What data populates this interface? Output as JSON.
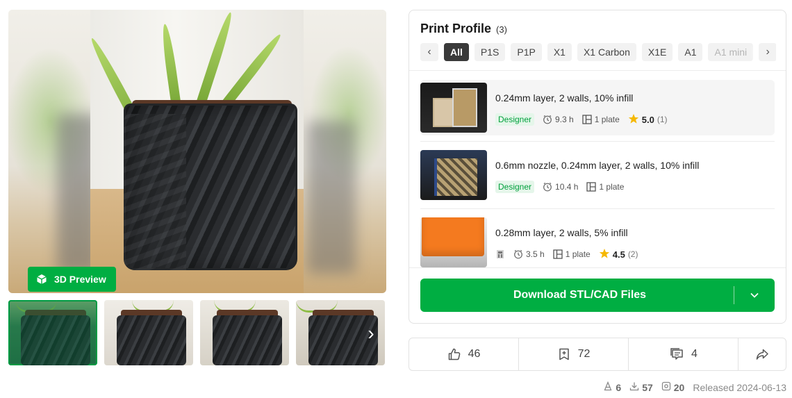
{
  "gallery": {
    "preview_button_label": "3D Preview",
    "next_icon": "chevron-right-icon"
  },
  "print_profile": {
    "title": "Print Profile",
    "count": "(3)",
    "filters": [
      "All",
      "P1S",
      "P1P",
      "X1",
      "X1 Carbon",
      "X1E",
      "A1",
      "A1 mini"
    ],
    "active_filter": "All",
    "profiles": [
      {
        "name": "0.24mm layer, 2 walls, 10% infill",
        "badge": "Designer",
        "time": "9.3 h",
        "plates": "1 plate",
        "rating": "5.0",
        "rating_count": "(1)"
      },
      {
        "name": "0.6mm nozzle, 0.24mm layer, 2 walls, 10% infill",
        "badge": "Designer",
        "time": "10.4 h",
        "plates": "1 plate"
      },
      {
        "name": "0.28mm layer, 2 walls, 5% infill",
        "time": "3.5 h",
        "plates": "1 plate",
        "rating": "4.5",
        "rating_count": "(2)"
      }
    ],
    "download_label": "Download STL/CAD Files"
  },
  "actions": {
    "likes": "46",
    "collects": "72",
    "comments": "4"
  },
  "stats": {
    "makes": "6",
    "downloads": "57",
    "prints": "20",
    "released": "Released 2024-06-13"
  },
  "colors": {
    "brand_green": "#00ae42",
    "designer_badge_bg": "#e5f6ea",
    "star_yellow": "#f5b800",
    "active_chip": "#3a3a3a"
  }
}
